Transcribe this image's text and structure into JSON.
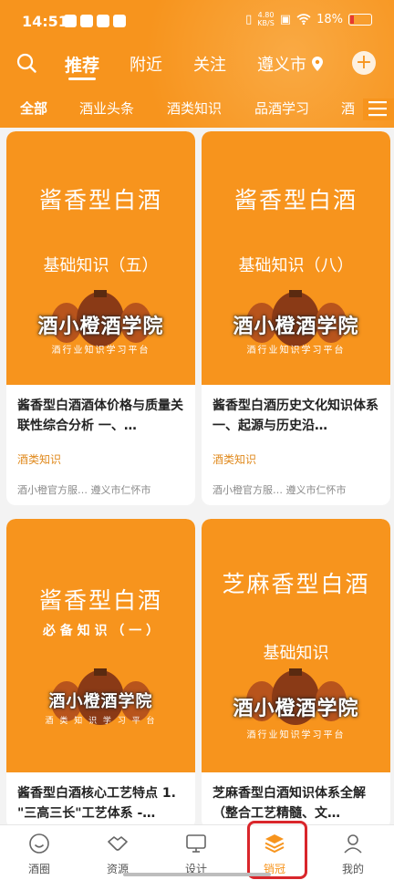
{
  "status": {
    "time": "14:51",
    "speed": "4.80\nKB/S",
    "battery": "18%"
  },
  "topnav": {
    "tabs": [
      "推荐",
      "附近",
      "关注"
    ],
    "active_tab": "推荐",
    "city": "遵义市",
    "add_label": "+"
  },
  "categories": [
    "全部",
    "酒业头条",
    "酒类知识",
    "品酒学习",
    "酒"
  ],
  "cards": [
    {
      "cover_title": "酱香型白酒",
      "cover_sub": "基础知识（五）",
      "brand": "酒小橙酒学院",
      "slogan": "酒行业知识学习平台",
      "title": "酱香型白酒酒体价格与质量关联性综合分析 一、…",
      "tag": "酒类知识",
      "source": "酒小橙官方服…   遵义市仁怀市"
    },
    {
      "cover_title": "酱香型白酒",
      "cover_sub": "基础知识（八）",
      "brand": "酒小橙酒学院",
      "slogan": "酒行业知识学习平台",
      "title": "酱香型白酒历史文化知识体系 一、起源与历史沿…",
      "tag": "酒类知识",
      "source": "酒小橙官方服…   遵义市仁怀市"
    },
    {
      "cover_title": "酱香型白酒",
      "cover_sub": "必 备 知 识 （ 一 ）",
      "brand": "酒小橙酒学院",
      "slogan": "酒 类 知 识 学 习 平 台",
      "title": "酱香型白酒核心工艺特点 1. \"三高三长\"工艺体系 -…"
    },
    {
      "cover_title": "芝麻香型白酒",
      "cover_sub": "基础知识",
      "brand": "酒小橙酒学院",
      "slogan": "酒行业知识学习平台",
      "title": "芝麻香型白酒知识体系全解 （整合工艺精髓、文…"
    }
  ],
  "bottom_nav": [
    {
      "label": "酒圈",
      "icon": "smile-icon"
    },
    {
      "label": "资源",
      "icon": "handshake-icon"
    },
    {
      "label": "设计",
      "icon": "monitor-icon"
    },
    {
      "label": "销冠",
      "icon": "layers-icon",
      "active": true
    },
    {
      "label": "我的",
      "icon": "person-icon"
    }
  ],
  "colors": {
    "brand": "#f7941d",
    "highlight": "#d9262b",
    "tag": "#e08a1e"
  }
}
